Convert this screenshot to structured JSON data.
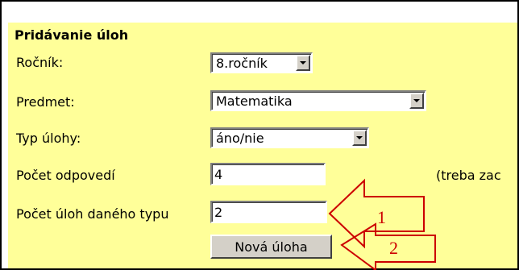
{
  "form": {
    "title": "Pridávanie úloh",
    "rocnik": {
      "label": "Ročník:",
      "value": "8.ročník"
    },
    "predmet": {
      "label": "Predmet:",
      "value": "Matematika"
    },
    "typ": {
      "label": "Typ úlohy:",
      "value": "áno/nie"
    },
    "pocet_odpovedi": {
      "label": "Počet odpovedí",
      "value": "4",
      "note": "(treba zac"
    },
    "pocet_uloh": {
      "label": "Počet úloh daného typu",
      "value": "2"
    },
    "submit_label": "Nová úloha"
  },
  "annotations": {
    "arrow1_number": "1",
    "arrow2_number": "2",
    "color": "#cc0000"
  }
}
